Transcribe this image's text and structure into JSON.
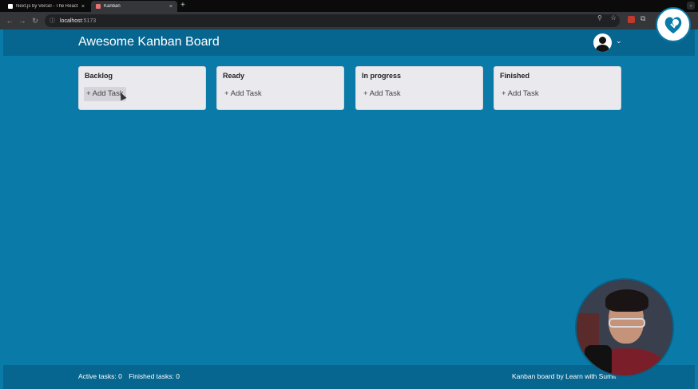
{
  "browser": {
    "tabs": [
      {
        "title": "Next.js by Vercel - The React",
        "close": "×"
      },
      {
        "title": "Kanban",
        "close": "×"
      }
    ],
    "new_tab": "+",
    "tab_menu": "⌄",
    "url_host": "localhost",
    "url_port": ":5173"
  },
  "app": {
    "title": "Awesome Kanban Board",
    "columns": [
      {
        "title": "Backlog",
        "add_label": "+ Add Task"
      },
      {
        "title": "Ready",
        "add_label": "+ Add Task"
      },
      {
        "title": "In progress",
        "add_label": "+ Add Task"
      },
      {
        "title": "Finished",
        "add_label": "+ Add Task"
      }
    ]
  },
  "footer": {
    "active_tasks": "Active tasks: 0",
    "finished_tasks": "Finished tasks: 0",
    "credit": "Kanban board by Learn with Sumit"
  },
  "colors": {
    "app_background": "#0a7aa8",
    "header_background": "#076690",
    "column_background": "#e9e9ee"
  }
}
